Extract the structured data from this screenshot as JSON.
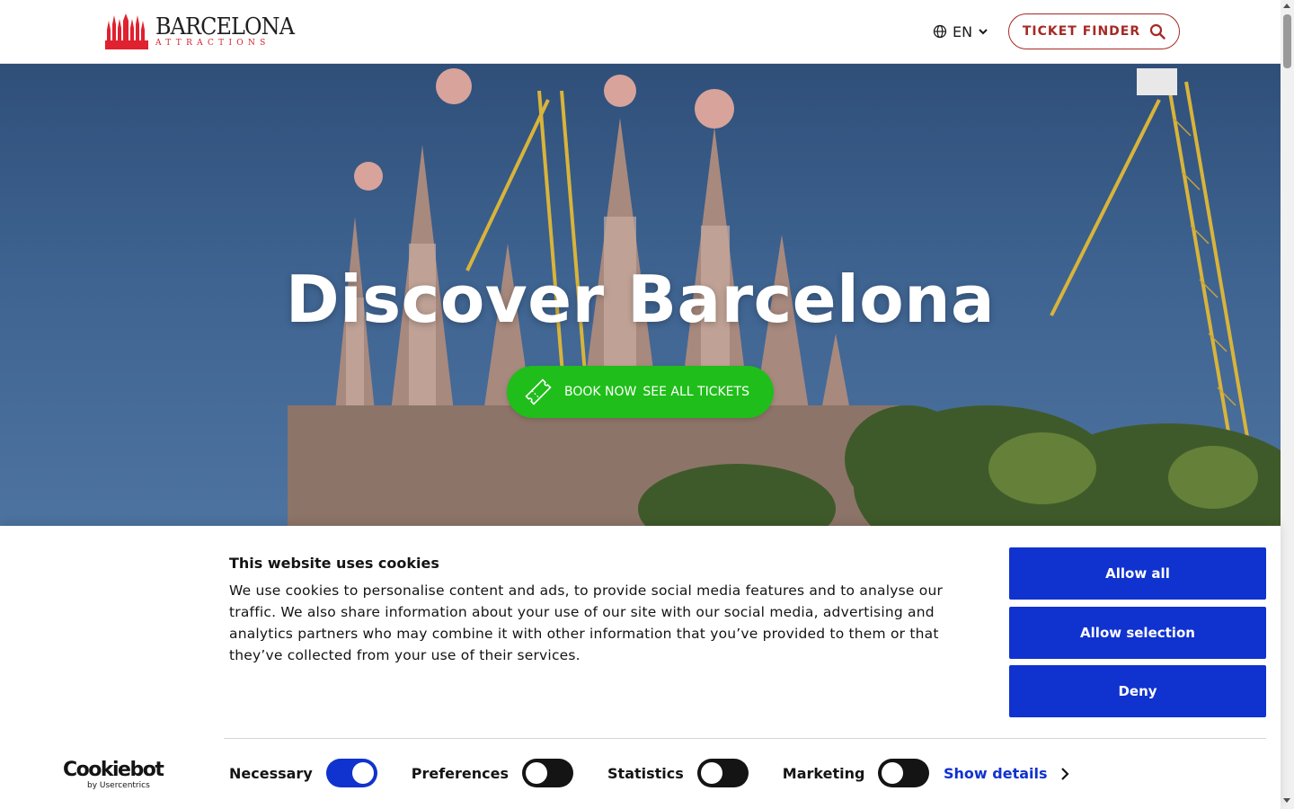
{
  "header": {
    "logo_main": "BARCELONA",
    "logo_sub": "ATTRACTIONS",
    "language": "EN",
    "ticket_finder_label": "TICKET FINDER"
  },
  "hero": {
    "title": "Discover Barcelona",
    "book_label": "BOOK NOW",
    "tickets_label": "SEE ALL TICKETS"
  },
  "cookie_banner": {
    "title": "This website uses cookies",
    "body": "We use cookies to personalise content and ads, to provide social media features and to analyse our traffic. We also share information about your use of our site with our social media, advertising and analytics partners who may combine it with other information that you’ve provided to them or that they’ve collected from your use of their services.",
    "buttons": {
      "allow_all": "Allow all",
      "allow_selection": "Allow selection",
      "deny": "Deny"
    },
    "toggles": [
      {
        "label": "Necessary",
        "on": true
      },
      {
        "label": "Preferences",
        "on": false
      },
      {
        "label": "Statistics",
        "on": false
      },
      {
        "label": "Marketing",
        "on": false
      }
    ],
    "show_details": "Show details",
    "brand_main": "Cookiebot",
    "brand_sub": "by Usercentrics"
  },
  "colors": {
    "brand_red": "#a52a24",
    "book_green": "#1fbe1a",
    "cookie_blue": "#1032cf"
  },
  "icons": [
    "logo-cathedral-icon",
    "globe-icon",
    "chevron-down-icon",
    "search-icon",
    "ticket-icon",
    "chevron-right-icon"
  ]
}
